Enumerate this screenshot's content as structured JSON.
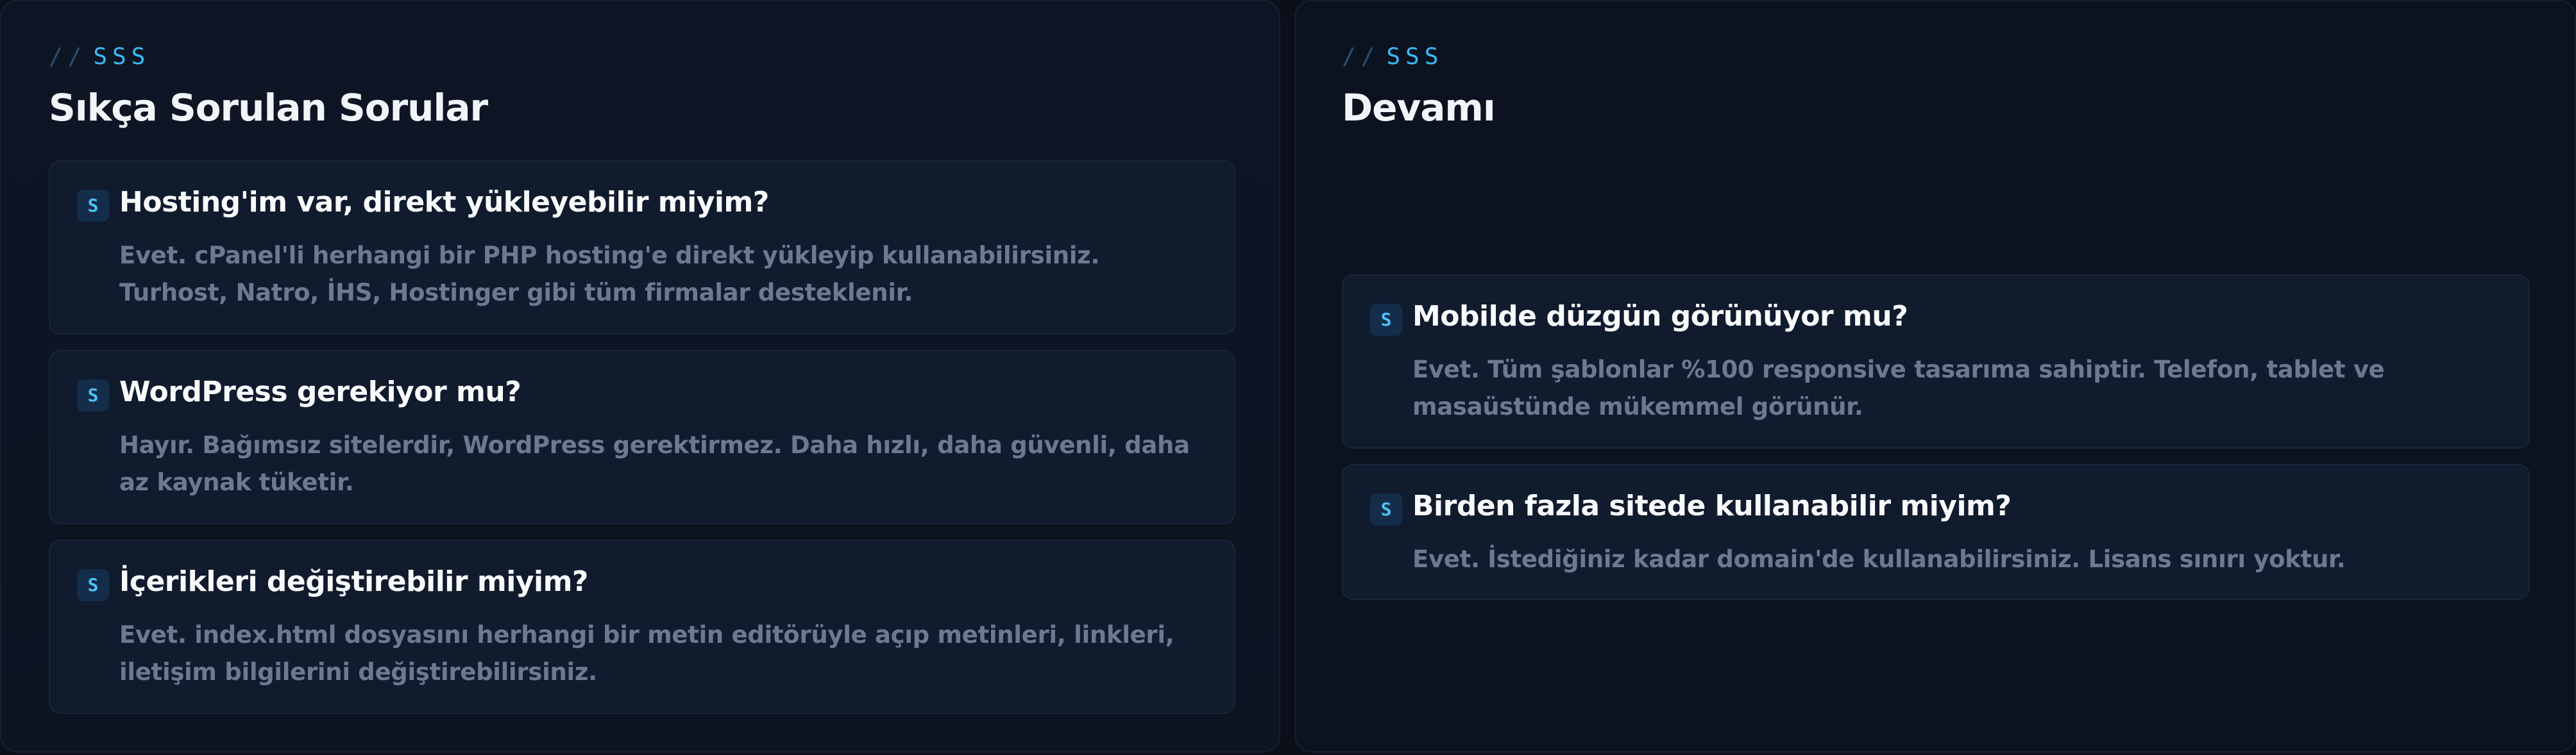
{
  "left": {
    "eyebrow_slash": "//",
    "eyebrow": "SSS",
    "title": "Sıkça Sorulan Sorular",
    "items": [
      {
        "badge": "S",
        "question": "Hosting'im var, direkt yükleyebilir miyim?",
        "answer": "Evet. cPanel'li herhangi bir PHP hosting'e direkt yükleyip kullanabilirsiniz. Turhost, Natro, İHS, Hostinger gibi tüm firmalar desteklenir."
      },
      {
        "badge": "S",
        "question": "WordPress gerekiyor mu?",
        "answer": "Hayır. Bağımsız sitelerdir, WordPress gerektirmez. Daha hızlı, daha güvenli, daha az kaynak tüketir."
      },
      {
        "badge": "S",
        "question": "İçerikleri değiştirebilir miyim?",
        "answer": "Evet. index.html dosyasını herhangi bir metin editörüyle açıp metinleri, linkleri, iletişim bilgilerini değiştirebilirsiniz."
      }
    ]
  },
  "right": {
    "eyebrow_slash": "//",
    "eyebrow": "SSS",
    "title": "Devamı",
    "items": [
      {
        "badge": "S",
        "question": "Mobilde düzgün görünüyor mu?",
        "answer": "Evet. Tüm şablonlar %100 responsive tasarıma sahiptir. Telefon, tablet ve masaüstünde mükemmel görünür."
      },
      {
        "badge": "S",
        "question": "Birden fazla sitede kullanabilir miyim?",
        "answer": "Evet. İstediğiniz kadar domain'de kullanabilirsiniz. Lisans sınırı yoktur."
      }
    ]
  },
  "colors": {
    "background": "#0a0f1a",
    "card": "#111b2e",
    "accent": "#38bdf8",
    "question": "#f8fafc",
    "answer": "#6b7a90"
  }
}
